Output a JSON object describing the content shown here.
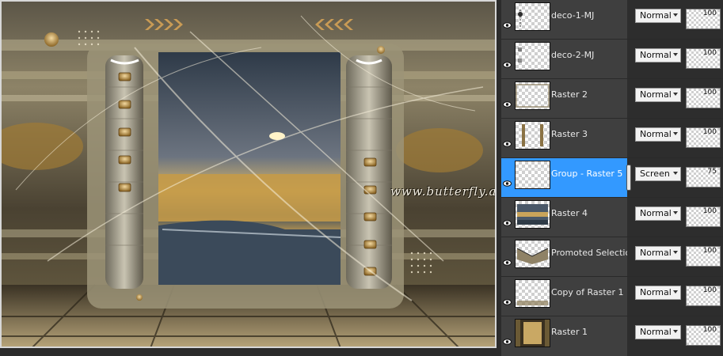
{
  "canvas": {
    "watermark": "www.butterfly.ado.br - Maria José"
  },
  "layers": [
    {
      "name": "deco-1-MJ",
      "blend": "Normal",
      "opacity": "100",
      "active": false,
      "thumb": "deco1"
    },
    {
      "name": "deco-2-MJ",
      "blend": "Normal",
      "opacity": "100",
      "active": false,
      "thumb": "deco2"
    },
    {
      "name": "Raster 2",
      "blend": "Normal",
      "opacity": "100",
      "active": false,
      "thumb": "raster2"
    },
    {
      "name": "Raster 3",
      "blend": "Normal",
      "opacity": "100",
      "active": false,
      "thumb": "raster3"
    },
    {
      "name": "Group - Raster 5",
      "blend": "Screen",
      "opacity": "75",
      "active": true,
      "thumb": "group5"
    },
    {
      "name": "Raster 4",
      "blend": "Normal",
      "opacity": "100",
      "active": false,
      "thumb": "raster4"
    },
    {
      "name": "Promoted Selection",
      "blend": "Normal",
      "opacity": "100",
      "active": false,
      "thumb": "promoted"
    },
    {
      "name": "Copy of Raster 1",
      "blend": "Normal",
      "opacity": "100",
      "active": false,
      "thumb": "copyraster1"
    },
    {
      "name": "Raster 1",
      "blend": "Normal",
      "opacity": "100",
      "active": false,
      "thumb": "raster1"
    }
  ],
  "colors": {
    "selection": "#3399ff",
    "panel_bg": "#3d3d3d",
    "props_bg": "#2d2d2d"
  },
  "icons": {
    "visibility": "eye-icon",
    "dropdown": "chevron-down-icon"
  }
}
